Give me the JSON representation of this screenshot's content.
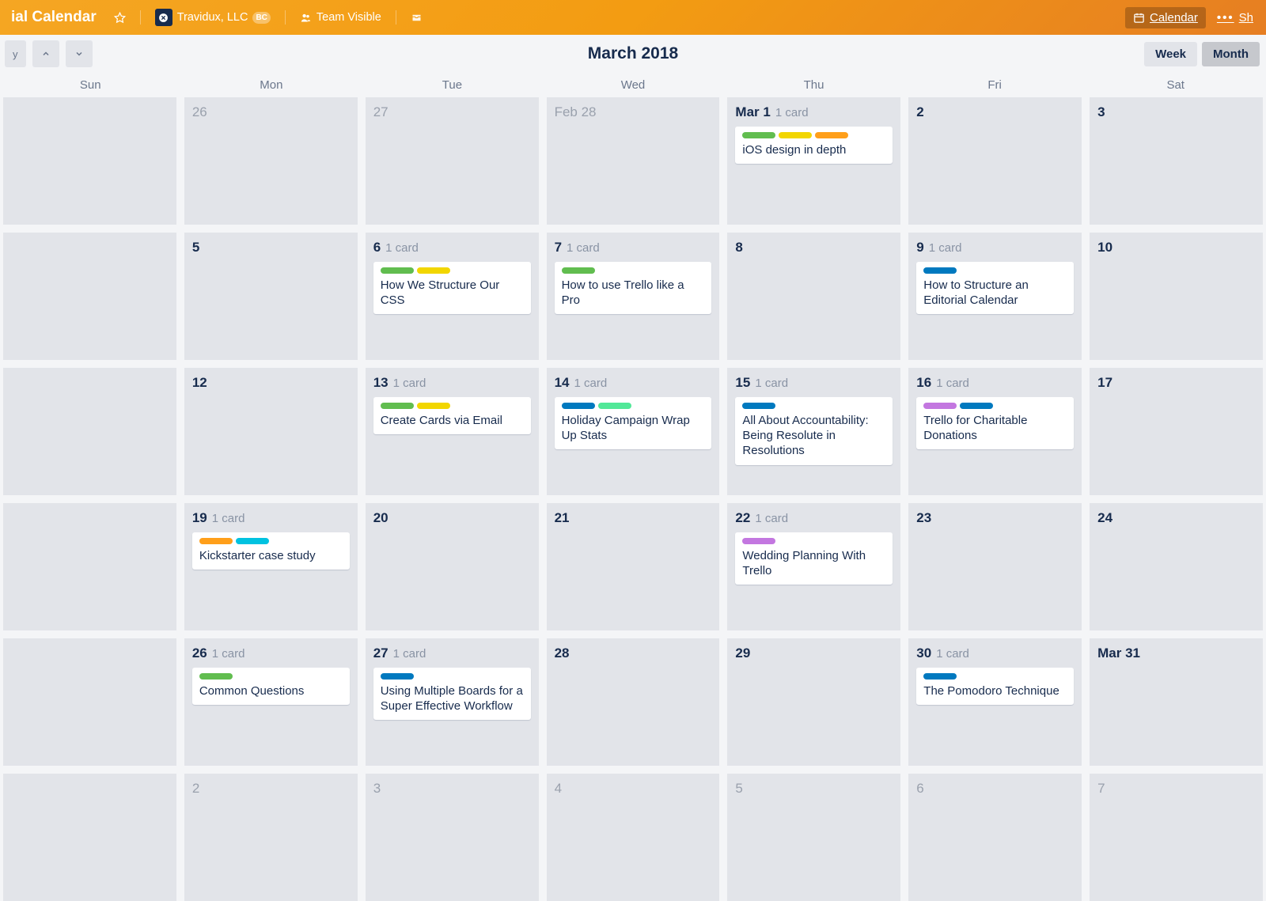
{
  "header": {
    "board_title": "ial Calendar",
    "team_name": "Travidux, LLC",
    "team_badge": "BC",
    "visibility": "Team Visible",
    "calendar_link": "Calendar",
    "show_menu_partial": "Sh"
  },
  "toolbar": {
    "today_partial": "y",
    "month_label": "March 2018",
    "view_week": "Week",
    "view_month": "Month"
  },
  "weekdays": [
    "Sun",
    "Mon",
    "Tue",
    "Wed",
    "Thu",
    "Fri",
    "Sat"
  ],
  "card_count_suffix": "1 card",
  "label_colors": {
    "green": "c-green",
    "yellow": "c-yellow",
    "orange": "c-orange",
    "blue": "c-blue",
    "sky": "c-sky",
    "purple": "c-purple",
    "teal": "c-teal"
  },
  "weeks": [
    [
      {
        "num": "",
        "out": true
      },
      {
        "num": "26",
        "out": true
      },
      {
        "num": "27",
        "out": true
      },
      {
        "num": "Feb 28",
        "out": true
      },
      {
        "num": "Mar 1",
        "bold": true,
        "count": "1 card",
        "cards": [
          {
            "labels": [
              "green",
              "yellow",
              "orange"
            ],
            "title": "iOS design in depth"
          }
        ]
      },
      {
        "num": "2"
      },
      {
        "num": "3"
      }
    ],
    [
      {
        "num": ""
      },
      {
        "num": "5"
      },
      {
        "num": "6",
        "count": "1 card",
        "cards": [
          {
            "labels": [
              "green",
              "yellow"
            ],
            "title": "How We Structure Our CSS"
          }
        ]
      },
      {
        "num": "7",
        "count": "1 card",
        "cards": [
          {
            "labels": [
              "green"
            ],
            "title": "How to use Trello like a Pro"
          }
        ]
      },
      {
        "num": "8"
      },
      {
        "num": "9",
        "count": "1 card",
        "cards": [
          {
            "labels": [
              "blue"
            ],
            "title": "How to Structure an Editorial Calendar"
          }
        ]
      },
      {
        "num": "10"
      }
    ],
    [
      {
        "num": ""
      },
      {
        "num": "12"
      },
      {
        "num": "13",
        "count": "1 card",
        "cards": [
          {
            "labels": [
              "green",
              "yellow"
            ],
            "title": "Create Cards via Email"
          }
        ]
      },
      {
        "num": "14",
        "count": "1 card",
        "cards": [
          {
            "labels": [
              "blue",
              "teal"
            ],
            "title": "Holiday Campaign Wrap Up Stats"
          }
        ]
      },
      {
        "num": "15",
        "count": "1 card",
        "cards": [
          {
            "labels": [
              "blue"
            ],
            "title": "All About Accountability: Being Resolute in Resolutions"
          }
        ]
      },
      {
        "num": "16",
        "count": "1 card",
        "cards": [
          {
            "labels": [
              "purple",
              "blue"
            ],
            "title": "Trello for Charitable Donations"
          }
        ]
      },
      {
        "num": "17"
      }
    ],
    [
      {
        "num": ""
      },
      {
        "num": "19",
        "count": "1 card",
        "cards": [
          {
            "labels": [
              "orange",
              "sky"
            ],
            "title": "Kickstarter case study"
          }
        ]
      },
      {
        "num": "20"
      },
      {
        "num": "21"
      },
      {
        "num": "22",
        "count": "1 card",
        "cards": [
          {
            "labels": [
              "purple"
            ],
            "title": "Wedding Planning With Trello"
          }
        ]
      },
      {
        "num": "23"
      },
      {
        "num": "24"
      }
    ],
    [
      {
        "num": ""
      },
      {
        "num": "26",
        "count": "1 card",
        "cards": [
          {
            "labels": [
              "green"
            ],
            "title": "Common Questions"
          }
        ]
      },
      {
        "num": "27",
        "count": "1 card",
        "cards": [
          {
            "labels": [
              "blue"
            ],
            "title": "Using Multiple Boards for a Super Effective Workflow"
          }
        ]
      },
      {
        "num": "28"
      },
      {
        "num": "29"
      },
      {
        "num": "30",
        "count": "1 card",
        "cards": [
          {
            "labels": [
              "blue"
            ],
            "title": "The Pomodoro Technique"
          }
        ]
      },
      {
        "num": "Mar 31",
        "bold": true
      }
    ],
    [
      {
        "num": ""
      },
      {
        "num": "2",
        "out": true,
        "light": true
      },
      {
        "num": "3",
        "out": true,
        "light": true
      },
      {
        "num": "4",
        "out": true,
        "light": true
      },
      {
        "num": "5",
        "out": true,
        "light": true
      },
      {
        "num": "6",
        "out": true,
        "light": true
      },
      {
        "num": "7",
        "out": true,
        "light": true
      }
    ]
  ]
}
